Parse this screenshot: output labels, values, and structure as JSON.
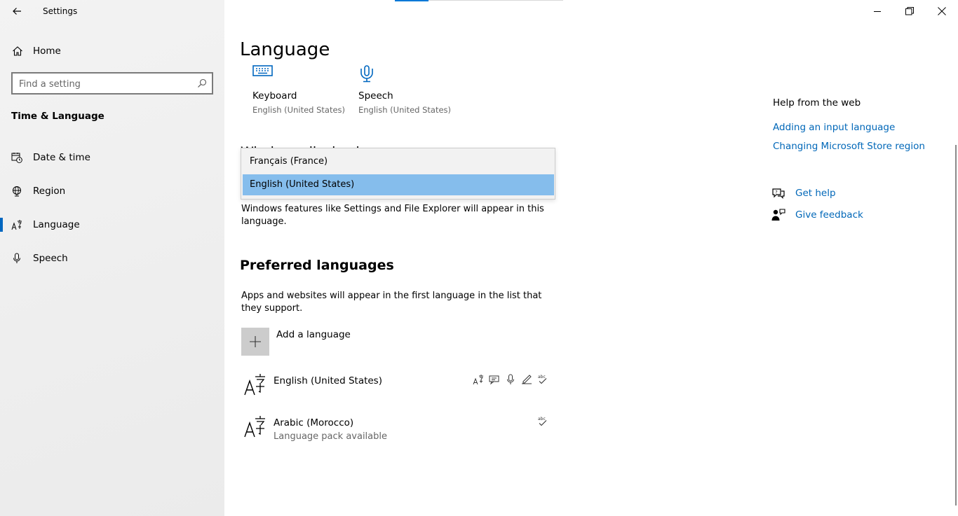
{
  "window": {
    "title": "Settings",
    "controls": {
      "minimize": "minimize",
      "restore": "restore",
      "close": "close"
    }
  },
  "sidebar": {
    "home_label": "Home",
    "search_placeholder": "Find a setting",
    "section_title": "Time & Language",
    "items": [
      {
        "label": "Date & time",
        "icon": "calendar-clock-icon"
      },
      {
        "label": "Region",
        "icon": "globe-icon"
      },
      {
        "label": "Language",
        "icon": "language-icon",
        "selected": true
      },
      {
        "label": "Speech",
        "icon": "microphone-icon"
      }
    ]
  },
  "main": {
    "page_title": "Language",
    "tiles": [
      {
        "name": "Keyboard",
        "sub": "English (United States)",
        "icon": "keyboard-icon"
      },
      {
        "name": "Speech",
        "sub": "English (United States)",
        "icon": "speech-icon"
      }
    ],
    "display_language": {
      "heading": "Windows display language",
      "options": [
        "Français (France)",
        "English (United States)"
      ],
      "selected": "English (United States)",
      "description": "Windows features like Settings and File Explorer will appear in this language."
    },
    "preferred": {
      "heading": "Preferred languages",
      "description": "Apps and websites will appear in the first language in the list that they support.",
      "add_label": "Add a language",
      "languages": [
        {
          "name": "English (United States)",
          "sub": "",
          "features": [
            "display-language-icon",
            "text-to-speech-icon",
            "speech-recognition-icon",
            "handwriting-icon",
            "spellcheck-icon"
          ]
        },
        {
          "name": "Arabic (Morocco)",
          "sub": "Language pack available",
          "features": [
            "spellcheck-icon"
          ]
        }
      ]
    }
  },
  "help": {
    "title": "Help from the web",
    "links": [
      "Adding an input language",
      "Changing Microsoft Store region"
    ],
    "get_help": "Get help",
    "give_feedback": "Give feedback"
  },
  "colors": {
    "accent": "#0067c0",
    "link": "#0067b8",
    "dropdown_selected": "#85bdec"
  }
}
